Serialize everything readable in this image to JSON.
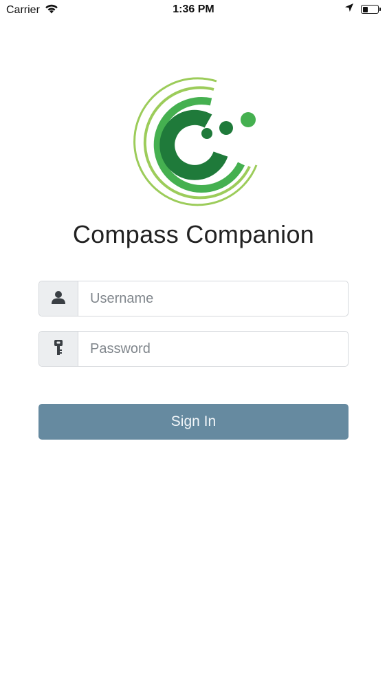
{
  "status_bar": {
    "carrier": "Carrier",
    "time": "1:36 PM",
    "battery_level": 0.35
  },
  "app": {
    "title": "Compass Companion"
  },
  "login": {
    "username_placeholder": "Username",
    "password_placeholder": "Password",
    "signin_label": "Sign In"
  },
  "colors": {
    "button": "#668aa0",
    "logo_dark_green": "#1f7a3a",
    "logo_green": "#45b050",
    "logo_light_green": "#9ccc5a"
  },
  "icons": {
    "username": "user-icon",
    "password": "key-icon",
    "signal": "wifi-icon",
    "location": "location-arrow-icon",
    "battery": "battery-icon"
  }
}
